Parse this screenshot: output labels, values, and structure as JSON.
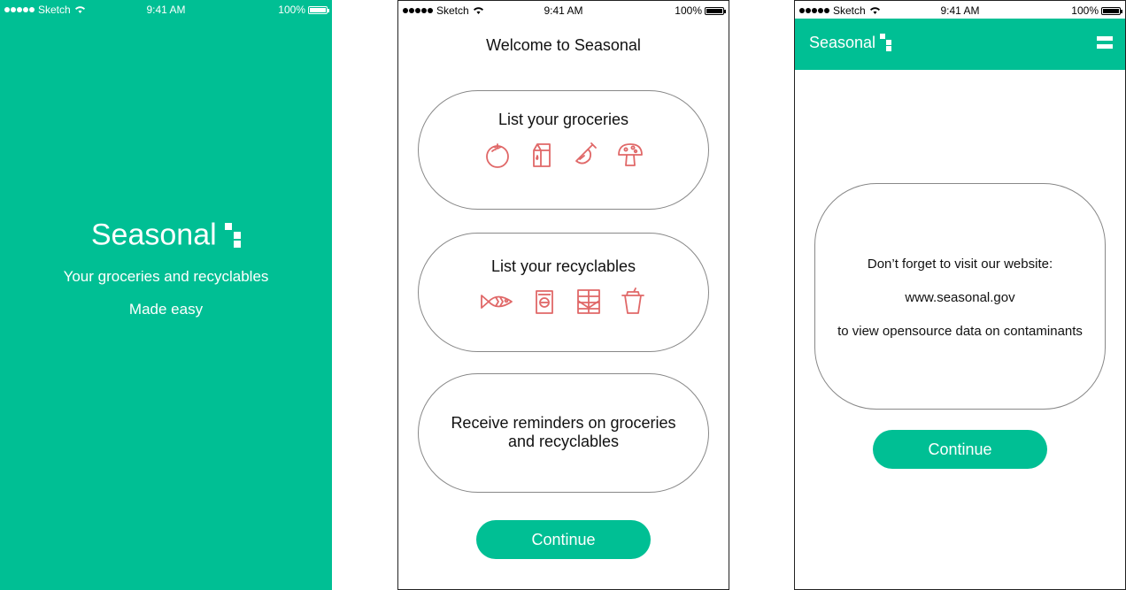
{
  "status_bar": {
    "carrier": "Sketch",
    "time": "9:41 AM",
    "battery": "100%"
  },
  "colors": {
    "brand": "#00bf94",
    "icon_stroke": "#e06868"
  },
  "splash": {
    "app_name": "Seasonal",
    "tagline": "Your groceries and recyclables",
    "subtitle": "Made easy"
  },
  "onboarding": {
    "title": "Welcome to Seasonal",
    "cards": [
      {
        "label": "List your groceries",
        "icons": [
          "tomato-icon",
          "milk-carton-icon",
          "ham-leg-icon",
          "mushroom-icon"
        ]
      },
      {
        "label": "List your recyclables",
        "icons": [
          "fish-icon",
          "can-icon",
          "chocolate-bar-icon",
          "cup-icon"
        ]
      },
      {
        "label_line1": "Receive reminders on groceries",
        "label_line2": "and recyclables"
      }
    ],
    "continue_label": "Continue"
  },
  "website_screen": {
    "brand": "Seasonal",
    "line1": "Don’t forget to visit our website:",
    "url": "www.seasonal.gov",
    "line3": "to view opensource data on contaminants",
    "continue_label": "Continue"
  }
}
